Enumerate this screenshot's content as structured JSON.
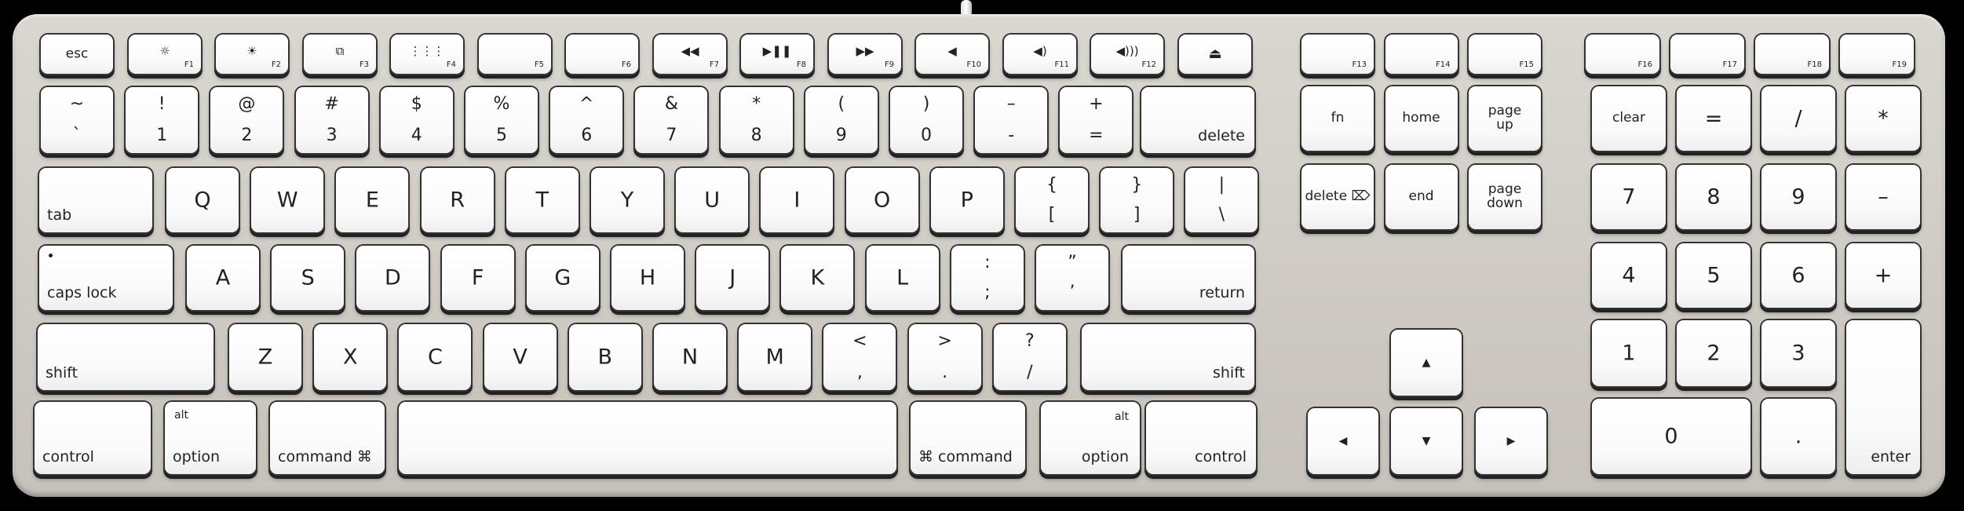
{
  "keyboard": {
    "function_row": [
      {
        "label": "esc"
      },
      {
        "fn": "F1",
        "icon": "brightness-down-icon",
        "glyph": "☼"
      },
      {
        "fn": "F2",
        "icon": "brightness-up-icon",
        "glyph": "☀"
      },
      {
        "fn": "F3",
        "icon": "expose-icon",
        "glyph": "⧉"
      },
      {
        "fn": "F4",
        "icon": "dashboard-icon",
        "glyph": "⋮⋮⋮"
      },
      {
        "fn": "F5"
      },
      {
        "fn": "F6"
      },
      {
        "fn": "F7",
        "icon": "rewind-icon",
        "glyph": "◀◀"
      },
      {
        "fn": "F8",
        "icon": "play-pause-icon",
        "glyph": "▶❚❚"
      },
      {
        "fn": "F9",
        "icon": "fast-forward-icon",
        "glyph": "▶▶"
      },
      {
        "fn": "F10",
        "icon": "mute-icon",
        "glyph": "◀"
      },
      {
        "fn": "F11",
        "icon": "volume-down-icon",
        "glyph": "◀)"
      },
      {
        "fn": "F12",
        "icon": "volume-up-icon",
        "glyph": "◀)))"
      },
      {
        "icon": "eject-icon",
        "glyph": "⏏"
      }
    ],
    "number_row": [
      {
        "top": "~",
        "bottom": "`"
      },
      {
        "top": "!",
        "bottom": "1"
      },
      {
        "top": "@",
        "bottom": "2"
      },
      {
        "top": "#",
        "bottom": "3"
      },
      {
        "top": "$",
        "bottom": "4"
      },
      {
        "top": "%",
        "bottom": "5"
      },
      {
        "top": "^",
        "bottom": "6"
      },
      {
        "top": "&",
        "bottom": "7"
      },
      {
        "top": "*",
        "bottom": "8"
      },
      {
        "top": "(",
        "bottom": "9"
      },
      {
        "top": ")",
        "bottom": "0"
      },
      {
        "top": "–",
        "bottom": "-"
      },
      {
        "top": "+",
        "bottom": "="
      },
      {
        "label": "delete"
      }
    ],
    "qwerty_row": [
      {
        "label": "tab"
      },
      {
        "label": "Q"
      },
      {
        "label": "W"
      },
      {
        "label": "E"
      },
      {
        "label": "R"
      },
      {
        "label": "T"
      },
      {
        "label": "Y"
      },
      {
        "label": "U"
      },
      {
        "label": "I"
      },
      {
        "label": "O"
      },
      {
        "label": "P"
      },
      {
        "top": "{",
        "bottom": "["
      },
      {
        "top": "}",
        "bottom": "]"
      },
      {
        "top": "|",
        "bottom": "\\"
      }
    ],
    "home_row": [
      {
        "label": "caps lock"
      },
      {
        "label": "A"
      },
      {
        "label": "S"
      },
      {
        "label": "D"
      },
      {
        "label": "F"
      },
      {
        "label": "G"
      },
      {
        "label": "H"
      },
      {
        "label": "J"
      },
      {
        "label": "K"
      },
      {
        "label": "L"
      },
      {
        "top": ":",
        "bottom": ";"
      },
      {
        "top": "”",
        "bottom": "’"
      },
      {
        "label": "return"
      }
    ],
    "shift_row": [
      {
        "label": "shift"
      },
      {
        "label": "Z"
      },
      {
        "label": "X"
      },
      {
        "label": "C"
      },
      {
        "label": "V"
      },
      {
        "label": "B"
      },
      {
        "label": "N"
      },
      {
        "label": "M"
      },
      {
        "top": "<",
        "bottom": ","
      },
      {
        "top": ">",
        "bottom": "."
      },
      {
        "top": "?",
        "bottom": "/"
      },
      {
        "label": "shift"
      }
    ],
    "bottom_row": [
      {
        "label": "control"
      },
      {
        "label": "option",
        "alt": "alt"
      },
      {
        "label": "command ⌘"
      },
      {
        "label": ""
      },
      {
        "label": "⌘ command"
      },
      {
        "label": "option",
        "alt": "alt"
      },
      {
        "label": "control"
      }
    ],
    "nav_function_row": [
      {
        "fn": "F13"
      },
      {
        "fn": "F14"
      },
      {
        "fn": "F15"
      }
    ],
    "nav_cluster": [
      {
        "label": "fn"
      },
      {
        "label": "home"
      },
      {
        "label": "page up"
      },
      {
        "label": "delete ⌦"
      },
      {
        "label": "end"
      },
      {
        "label": "page down"
      }
    ],
    "arrows": [
      {
        "icon": "arrow-up-icon",
        "glyph": "▲"
      },
      {
        "icon": "arrow-left-icon",
        "glyph": "◀"
      },
      {
        "icon": "arrow-down-icon",
        "glyph": "▼"
      },
      {
        "icon": "arrow-right-icon",
        "glyph": "▶"
      }
    ],
    "numpad_function_row": [
      {
        "fn": "F16"
      },
      {
        "fn": "F17"
      },
      {
        "fn": "F18"
      },
      {
        "fn": "F19"
      }
    ],
    "numpad": [
      {
        "label": "clear"
      },
      {
        "label": "="
      },
      {
        "label": "/"
      },
      {
        "label": "*"
      },
      {
        "label": "7"
      },
      {
        "label": "8"
      },
      {
        "label": "9"
      },
      {
        "label": "–"
      },
      {
        "label": "4"
      },
      {
        "label": "5"
      },
      {
        "label": "6"
      },
      {
        "label": "+"
      },
      {
        "label": "1"
      },
      {
        "label": "2"
      },
      {
        "label": "3"
      },
      {
        "label": "0"
      },
      {
        "label": "."
      },
      {
        "label": "enter"
      }
    ]
  }
}
